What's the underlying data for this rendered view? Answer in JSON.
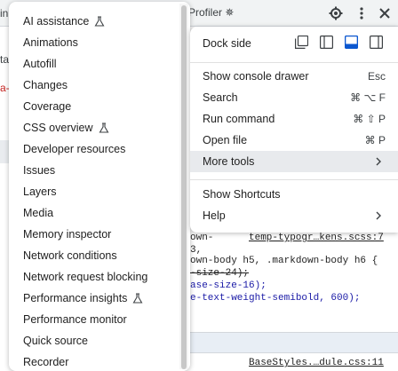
{
  "background": {
    "tab_title": "Profiler",
    "left_fragments": [
      "in",
      "ta",
      "a-"
    ],
    "code_lines": [
      {
        "text": "own-",
        "style": "plain"
      },
      {
        "text": "3,",
        "style": "plain"
      },
      {
        "text": "own-body h5, .markdown-body h6 {",
        "style": "plain"
      },
      {
        "text": "-size-24);",
        "style": "strike"
      },
      {
        "text": "ase-size-16);",
        "style": "blue"
      },
      {
        "text": "e-text-weight-semibold, 600);",
        "style": "blue"
      }
    ],
    "source_link_1": "temp-typogr…kens.scss:7",
    "source_link_2": "BaseStyles.…dule.css:11"
  },
  "more_tools": {
    "items": [
      {
        "label": "AI assistance",
        "experimental": true
      },
      {
        "label": "Animations",
        "experimental": false
      },
      {
        "label": "Autofill",
        "experimental": false
      },
      {
        "label": "Changes",
        "experimental": false
      },
      {
        "label": "Coverage",
        "experimental": false
      },
      {
        "label": "CSS overview",
        "experimental": true
      },
      {
        "label": "Developer resources",
        "experimental": false
      },
      {
        "label": "Issues",
        "experimental": false
      },
      {
        "label": "Layers",
        "experimental": false
      },
      {
        "label": "Media",
        "experimental": false
      },
      {
        "label": "Memory inspector",
        "experimental": false
      },
      {
        "label": "Network conditions",
        "experimental": false
      },
      {
        "label": "Network request blocking",
        "experimental": false
      },
      {
        "label": "Performance insights",
        "experimental": true
      },
      {
        "label": "Performance monitor",
        "experimental": false
      },
      {
        "label": "Quick source",
        "experimental": false
      },
      {
        "label": "Recorder",
        "experimental": false
      }
    ]
  },
  "main_menu": {
    "dock_side_label": "Dock side",
    "dock_options": [
      "undock-icon",
      "dock-left-icon",
      "dock-bottom-icon",
      "dock-right-icon"
    ],
    "selected_dock": "dock-bottom-icon",
    "items": [
      {
        "label": "Show console drawer",
        "shortcut": "Esc"
      },
      {
        "label": "Search",
        "shortcut": "⌘ ⌥ F"
      },
      {
        "label": "Run command",
        "shortcut": "⌘ ⇧ P"
      },
      {
        "label": "Open file",
        "shortcut": "⌘ P"
      },
      {
        "label": "More tools",
        "shortcut": ""
      }
    ],
    "items2": [
      {
        "label": "Show Shortcuts"
      },
      {
        "label": "Help"
      }
    ]
  },
  "colors": {
    "accent": "#0b57d0",
    "menu_hover": "#e8eaed"
  }
}
